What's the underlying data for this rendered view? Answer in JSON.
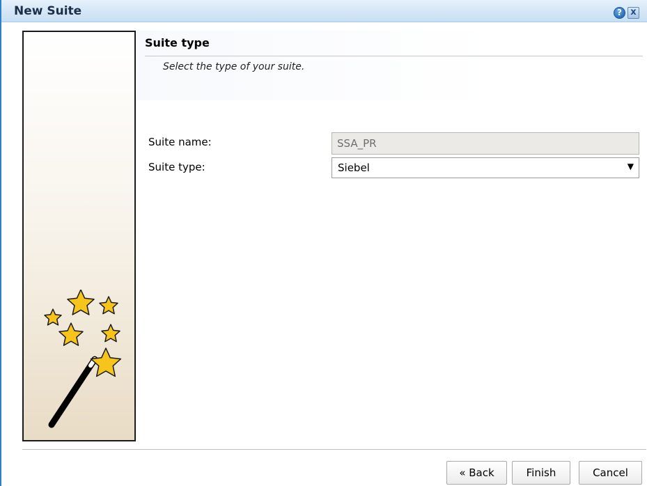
{
  "window": {
    "title": "New Suite",
    "help_glyph": "?",
    "close_glyph": "x",
    "icons": [
      "help-icon",
      "close-icon",
      "magic-wand-icon"
    ]
  },
  "step": {
    "title": "Suite type",
    "subtitle": "Select the type of your suite."
  },
  "form": {
    "suite_name_label": "Suite name:",
    "suite_name_value": "SSA_PR",
    "suite_type_label": "Suite type:",
    "suite_type_value": "Siebel",
    "dropdown_arrow": "▼"
  },
  "buttons": {
    "back": "« Back",
    "finish": "Finish",
    "cancel": "Cancel"
  },
  "colors": {
    "title_bar": "#d4e6f6",
    "disabled_input": "#ebeae7",
    "star_fill": "#f6c41d"
  }
}
